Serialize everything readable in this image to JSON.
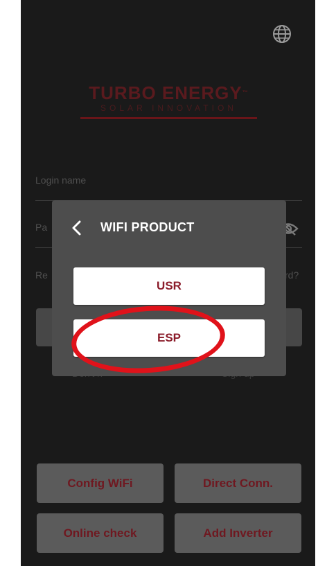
{
  "logo": {
    "title": "TURBO ENERGY",
    "subtitle": "SOLAR INNOVATION"
  },
  "login": {
    "login_name_label": "Login name",
    "password_label_fragment": "Pa",
    "remember_fragment": "Re",
    "forgot_fragment": "rd?",
    "dont_have_fragment": "Don't h",
    "sign_up_label": "Sign up"
  },
  "modal": {
    "title": "WIFI PRODUCT",
    "options": [
      "USR",
      "ESP"
    ]
  },
  "bottom_buttons": {
    "config_wifi": "Config WiFi",
    "direct_conn": "Direct Conn.",
    "online_check": "Online check",
    "add_inverter": "Add Inverter"
  },
  "colors": {
    "accent": "#8b1c2a",
    "annotation_circle": "#e0121a",
    "modal_bg": "#4d4d4d",
    "background": "#1a1a1a"
  }
}
